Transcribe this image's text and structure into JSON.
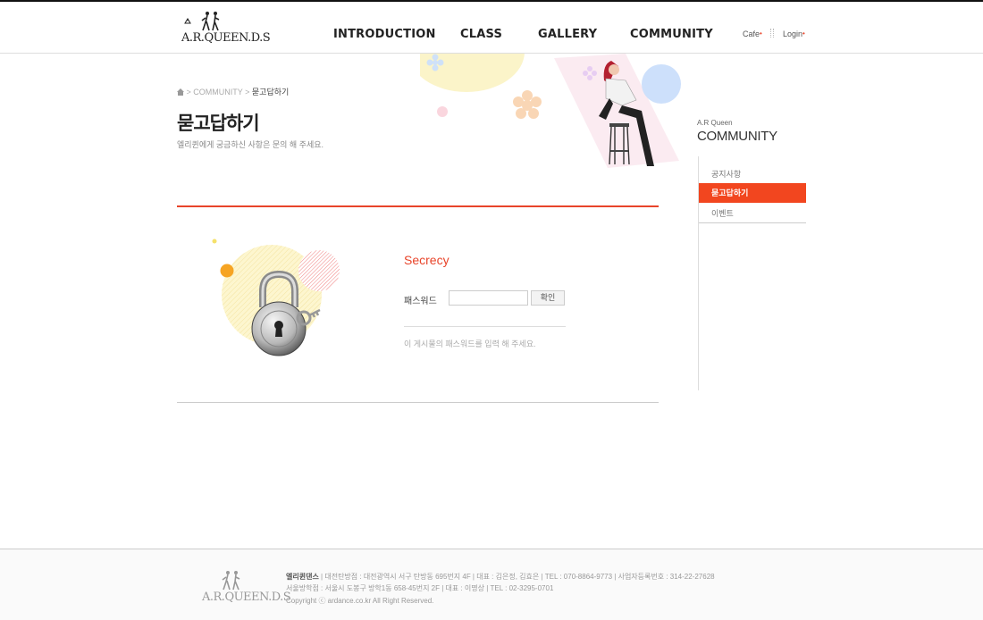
{
  "header": {
    "logo_text": "A.R.QUEEN.D.S",
    "nav": [
      "INTRODUCTION",
      "CLASS",
      "GALLERY",
      "COMMUNITY"
    ],
    "util": {
      "cafe": "Cafe",
      "login": "Login"
    }
  },
  "breadcrumb": {
    "section": "COMMUNITY",
    "current": "묻고답하기"
  },
  "page": {
    "title": "묻고답하기",
    "description": "엘리퀸에게 궁금하신 사항은 문의 해 주세요."
  },
  "form": {
    "heading": "Secrecy",
    "password_label": "패스워드",
    "password_value": "",
    "confirm_label": "확인",
    "note": "이 게시물의 패스워드를 입력 해 주세요."
  },
  "sidebar": {
    "subtitle": "A.R Queen",
    "title": "COMMUNITY",
    "items": [
      "공지사항",
      "묻고답하기",
      "이벤트"
    ],
    "active": "묻고답하기"
  },
  "footer": {
    "logo_text": "A.R.QUEEN.D.S",
    "company": "엘리퀸댄스",
    "line1": "|  대전탄방점 : 대전광역시 서구 탄방동 695번지 4F  |  대표 : 김은정, 김효은  |  TEL : 070-8864-9773  |  사업자등록번호 : 314-22-27628",
    "line2": "서울방학점 : 서울시 도봉구 방학1동 658-45번지 2F  |  대표 : 이명상  |  TEL : 02-3295-0701",
    "line3": "Copyright ⓒ ardance.co.kr  All Right Reserved."
  },
  "colors": {
    "accent": "#e8442a",
    "active_menu": "#f2461f"
  }
}
